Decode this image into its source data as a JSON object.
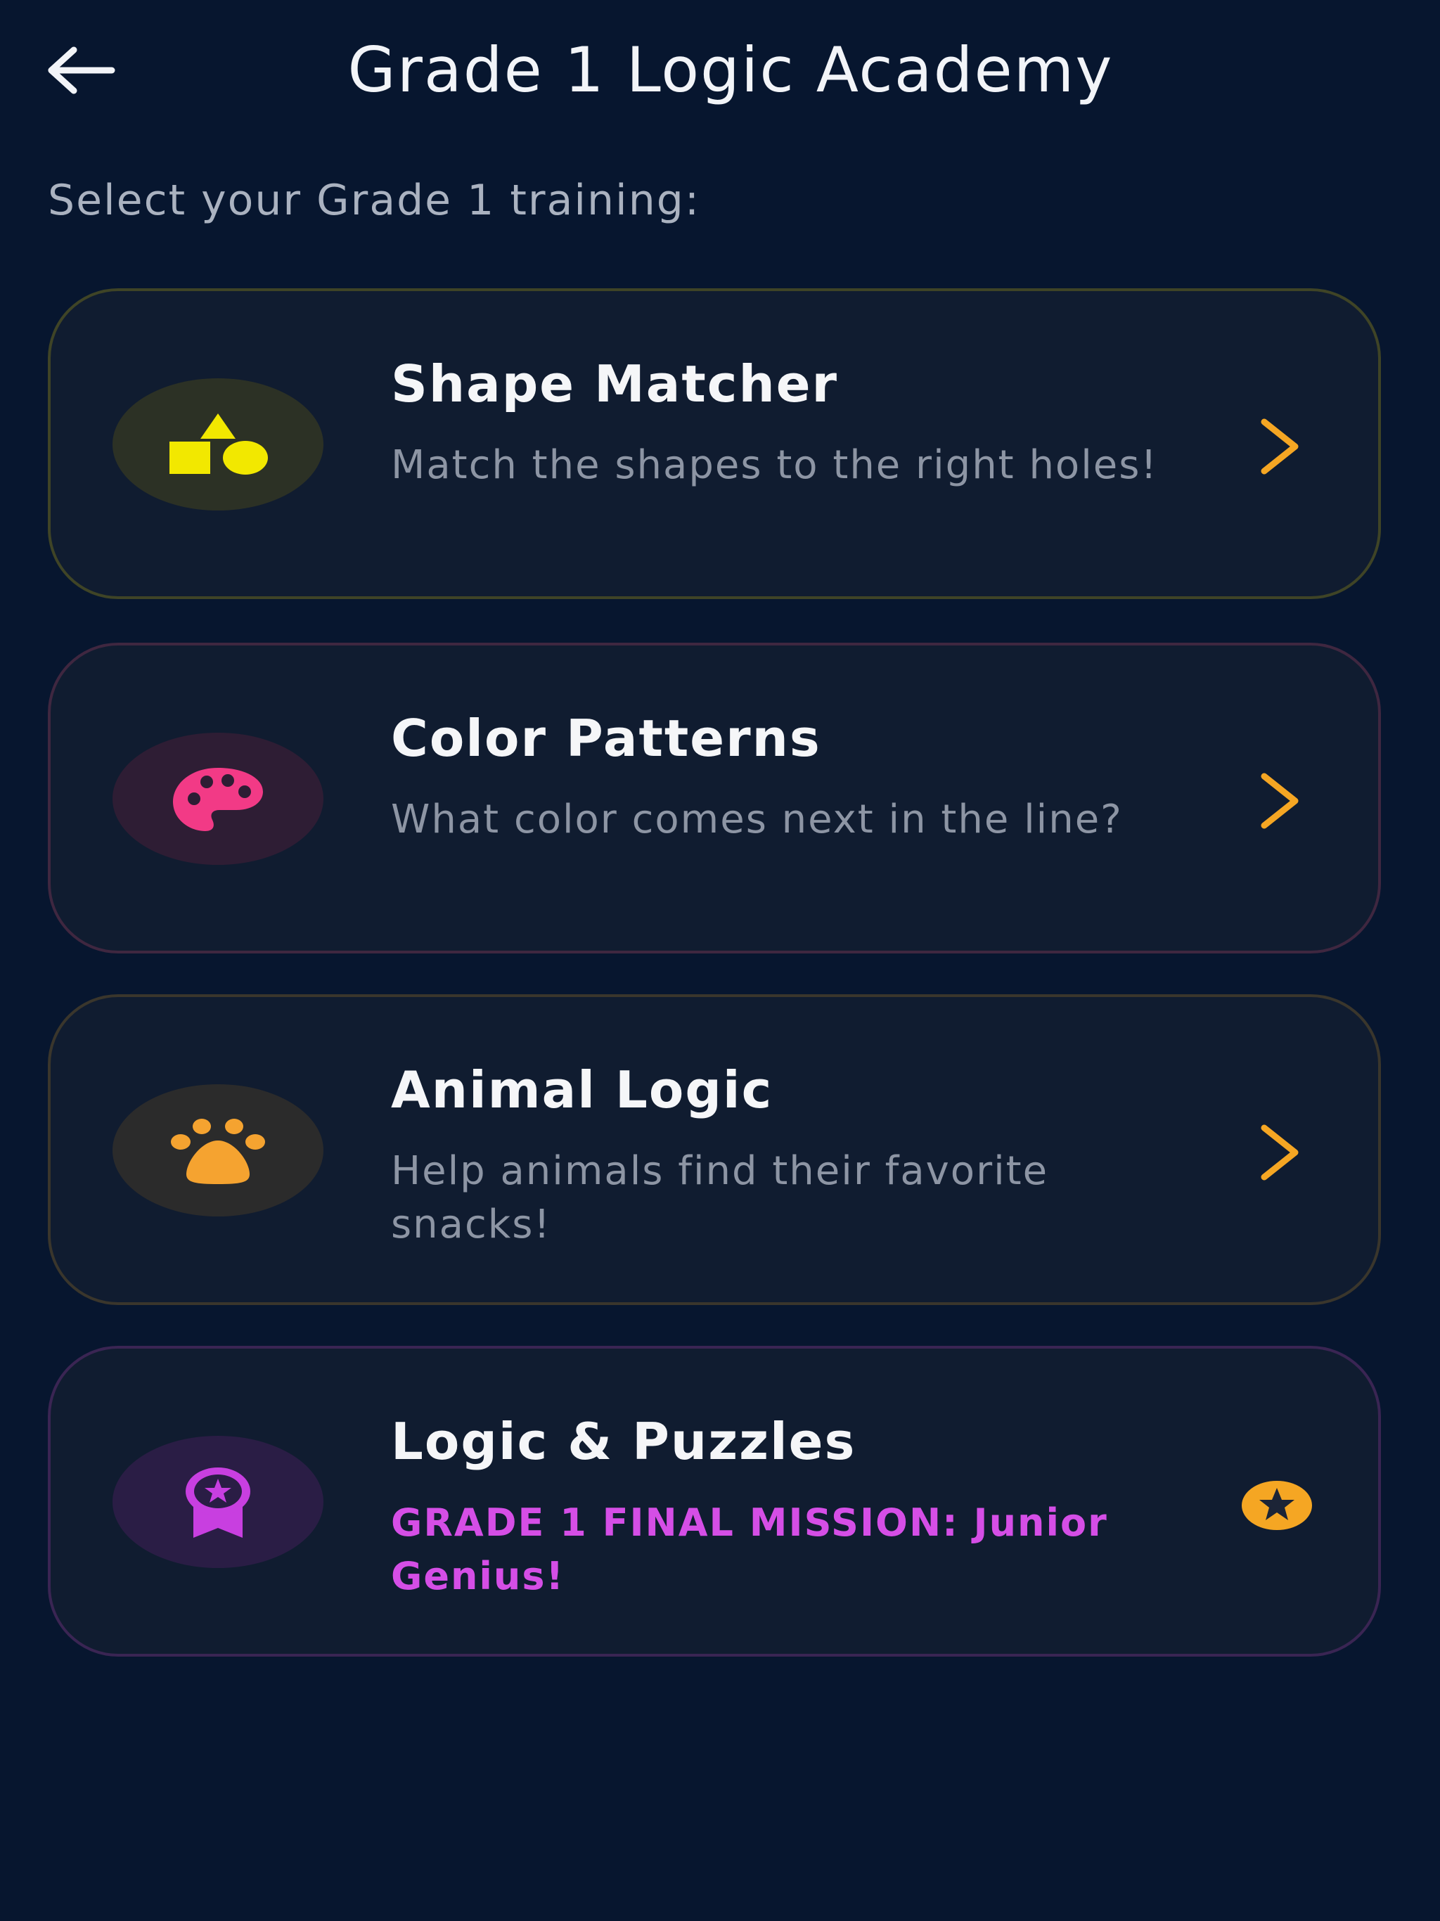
{
  "header": {
    "title": "Grade 1 Logic Academy",
    "back_icon": "arrow-left-icon"
  },
  "subtitle": "Select your Grade 1 training:",
  "colors": {
    "background": "#07162f",
    "chevron": "#f5a623"
  },
  "cards": [
    {
      "title": "Shape Matcher",
      "description": "Match the shapes to the right holes!",
      "icon": "shapes-icon",
      "accent": "#f2e800",
      "border": "#3f4426",
      "circle": "#2c3125",
      "action_icon": "chevron-right-icon"
    },
    {
      "title": "Color Patterns",
      "description": "What color comes next in the line?",
      "icon": "palette-icon",
      "accent": "#f23a86",
      "border": "#3f2740",
      "circle": "#2e1d34",
      "action_icon": "chevron-right-icon"
    },
    {
      "title": "Animal Logic",
      "description": "Help animals find their favorite snacks!",
      "icon": "paw-icon",
      "accent": "#f5a330",
      "border": "#3a362c",
      "circle": "#2b2b2b",
      "action_icon": "chevron-right-icon"
    },
    {
      "title": "Logic & Puzzles",
      "description": "GRADE 1 FINAL MISSION: Junior Genius!",
      "icon": "award-ribbon-icon",
      "accent": "#c83fe0",
      "border": "#3a2553",
      "circle": "#2a1d45",
      "action_icon": "star-badge-icon"
    }
  ]
}
